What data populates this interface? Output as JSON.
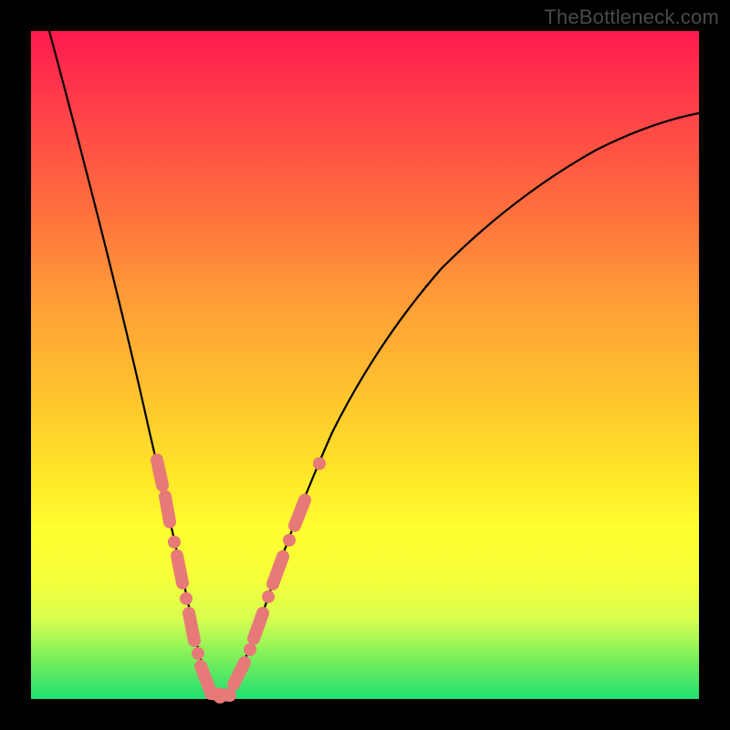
{
  "watermark": "TheBottleneck.com",
  "colors": {
    "curve": "#000000",
    "marker": "#e77a78",
    "background_black": "#000000"
  },
  "chart_data": {
    "type": "line",
    "title": "",
    "xlabel": "",
    "ylabel": "",
    "xlim": [
      0,
      100
    ],
    "ylim": [
      0,
      100
    ],
    "grid": false,
    "legend": false,
    "background": "vertical-gradient red→green",
    "description": "V-shaped bottleneck curve; y represents bottleneck severity (high=red, low=green). Minimum near x≈25.",
    "series": [
      {
        "name": "bottleneck_curve",
        "x": [
          0,
          5,
          10,
          15,
          18,
          20,
          22,
          24,
          25,
          26,
          28,
          30,
          33,
          37,
          42,
          50,
          60,
          70,
          80,
          90,
          100
        ],
        "y": [
          100,
          80,
          60,
          40,
          28,
          20,
          12,
          4,
          1,
          2,
          8,
          16,
          26,
          36,
          46,
          57,
          67,
          75,
          80,
          84,
          87
        ]
      }
    ],
    "markers": {
      "description": "salmon pill-shaped markers clustered near the curve minimum on both branches",
      "left_branch_marker_y_range": [
        4,
        38
      ],
      "right_branch_marker_y_range": [
        2,
        40
      ],
      "bottom_cluster_x_range": [
        22,
        28
      ]
    }
  }
}
